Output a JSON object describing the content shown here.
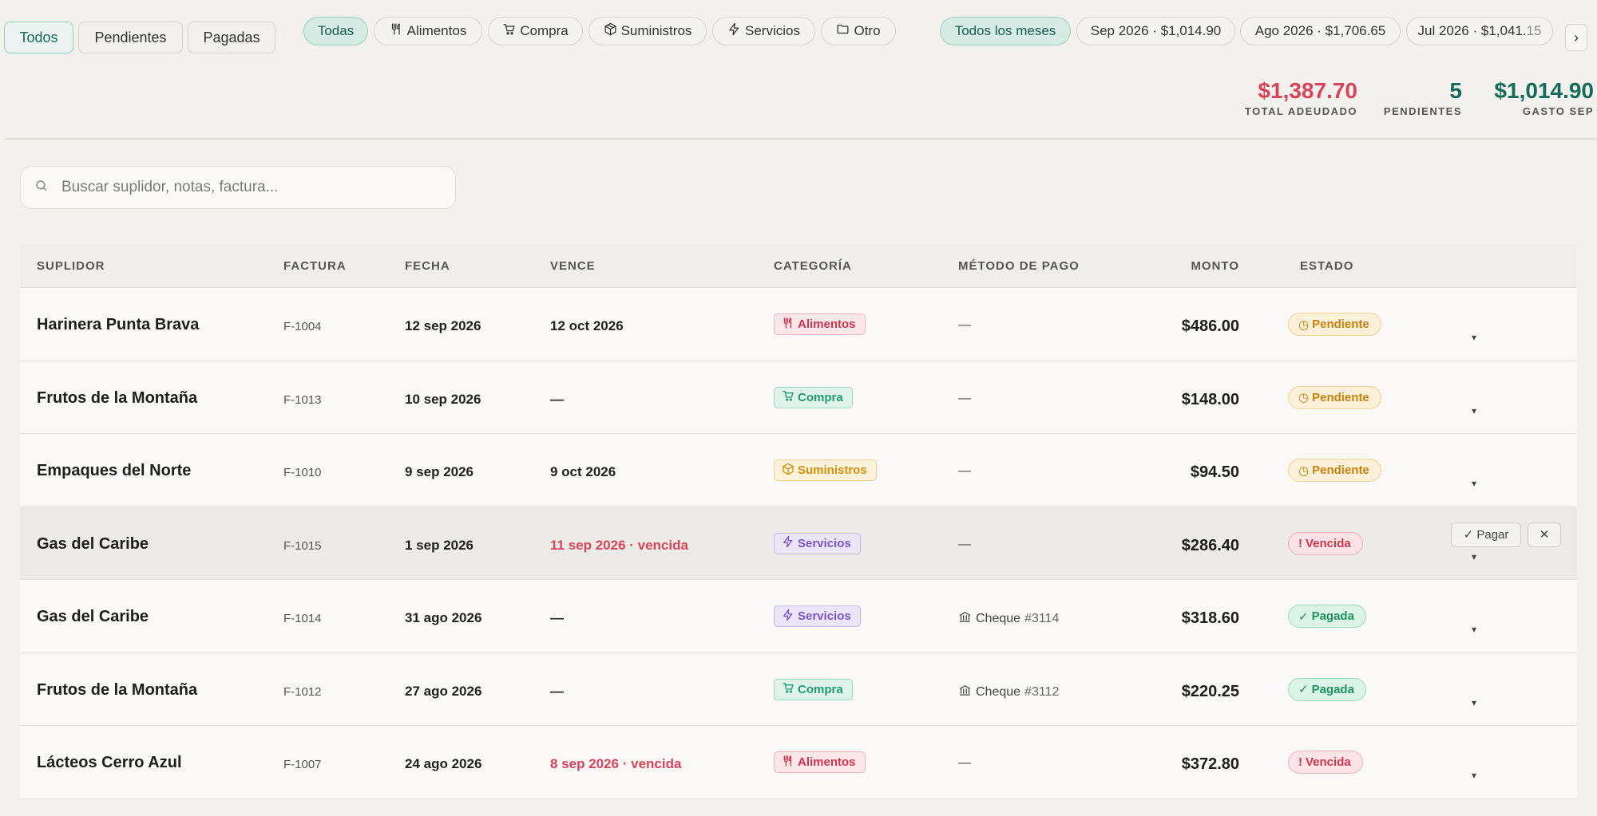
{
  "status_tabs": [
    {
      "label": "Todos",
      "active": true
    },
    {
      "label": "Pendientes",
      "active": false
    },
    {
      "label": "Pagadas",
      "active": false
    }
  ],
  "category_filters": [
    {
      "label": "Todas",
      "icon": "",
      "active": true
    },
    {
      "label": "Alimentos",
      "icon": "utensils-icon",
      "active": false
    },
    {
      "label": "Compra",
      "icon": "cart-icon",
      "active": false
    },
    {
      "label": "Suministros",
      "icon": "box-icon",
      "active": false
    },
    {
      "label": "Servicios",
      "icon": "bolt-icon",
      "active": false
    },
    {
      "label": "Otro",
      "icon": "folder-icon",
      "active": false
    }
  ],
  "month_filters": [
    {
      "label": "Todos los meses",
      "active": true
    },
    {
      "label": "Sep 2026 · $1,014.90",
      "active": false
    },
    {
      "label": "Ago 2026 · $1,706.65",
      "active": false
    },
    {
      "label": "Jul 2026 · $1,041.",
      "label_faded": "15",
      "active": false
    }
  ],
  "scroll_right_label": "›",
  "stats": {
    "total_owed": {
      "value": "$1,387.70",
      "label": "TOTAL ADEUDADO",
      "color": "#d9435a"
    },
    "pending": {
      "value": "5",
      "label": "PENDIENTES",
      "color": "#146c59"
    },
    "month_spend": {
      "value": "$1,014.90",
      "label": "GASTO SEP",
      "color": "#146c59"
    }
  },
  "search": {
    "placeholder": "Buscar suplidor, notas, factura...",
    "value": ""
  },
  "table": {
    "headers": {
      "supplier": "SUPLIDOR",
      "invoice": "FACTURA",
      "date": "FECHA",
      "due": "VENCE",
      "category": "CATEGORÍA",
      "payment_method": "MÉTODO DE PAGO",
      "amount": "MONTO",
      "status": "ESTADO"
    },
    "rows": [
      {
        "supplier": "Harinera Punta Brava",
        "invoice": "F-1004",
        "date": "12 sep 2026",
        "due": "12 oct 2026",
        "due_overdue": false,
        "category": "Alimentos",
        "category_key": "alimentos",
        "method": "—",
        "method_icon": false,
        "method_number": "",
        "amount": "$486.00",
        "status": "Pendiente",
        "status_key": "pendiente",
        "status_glyph": "◷",
        "hover": false
      },
      {
        "supplier": "Frutos de la Montaña",
        "invoice": "F-1013",
        "date": "10 sep 2026",
        "due": "—",
        "due_overdue": false,
        "category": "Compra",
        "category_key": "compra",
        "method": "—",
        "method_icon": false,
        "method_number": "",
        "amount": "$148.00",
        "status": "Pendiente",
        "status_key": "pendiente",
        "status_glyph": "◷",
        "hover": false
      },
      {
        "supplier": "Empaques del Norte",
        "invoice": "F-1010",
        "date": "9 sep 2026",
        "due": "9 oct 2026",
        "due_overdue": false,
        "category": "Suministros",
        "category_key": "suministros",
        "method": "—",
        "method_icon": false,
        "method_number": "",
        "amount": "$94.50",
        "status": "Pendiente",
        "status_key": "pendiente",
        "status_glyph": "◷",
        "hover": false
      },
      {
        "supplier": "Gas del Caribe",
        "invoice": "F-1015",
        "date": "1 sep 2026",
        "due": "11 sep 2026 · vencida",
        "due_overdue": true,
        "category": "Servicios",
        "category_key": "servicios",
        "method": "—",
        "method_icon": false,
        "method_number": "",
        "amount": "$286.40",
        "status": "Vencida",
        "status_key": "vencida",
        "status_glyph": "!",
        "hover": true
      },
      {
        "supplier": "Gas del Caribe",
        "invoice": "F-1014",
        "date": "31 ago 2026",
        "due": "—",
        "due_overdue": false,
        "category": "Servicios",
        "category_key": "servicios",
        "method": "Cheque",
        "method_icon": true,
        "method_number": "#3114",
        "amount": "$318.60",
        "status": "Pagada",
        "status_key": "pagada",
        "status_glyph": "✓",
        "hover": false
      },
      {
        "supplier": "Frutos de la Montaña",
        "invoice": "F-1012",
        "date": "27 ago 2026",
        "due": "—",
        "due_overdue": false,
        "category": "Compra",
        "category_key": "compra",
        "method": "Cheque",
        "method_icon": true,
        "method_number": "#3112",
        "amount": "$220.25",
        "status": "Pagada",
        "status_key": "pagada",
        "status_glyph": "✓",
        "hover": false
      },
      {
        "supplier": "Lácteos Cerro Azul",
        "invoice": "F-1007",
        "date": "24 ago 2026",
        "due": "8 sep 2026 · vencida",
        "due_overdue": true,
        "category": "Alimentos",
        "category_key": "alimentos",
        "method": "—",
        "method_icon": false,
        "method_number": "",
        "amount": "$372.80",
        "status": "Vencida",
        "status_key": "vencida",
        "status_glyph": "!",
        "hover": false
      }
    ],
    "row_actions": {
      "pay_label": "✓ Pagar",
      "delete_label": "✕",
      "expand_label": "▾"
    }
  }
}
